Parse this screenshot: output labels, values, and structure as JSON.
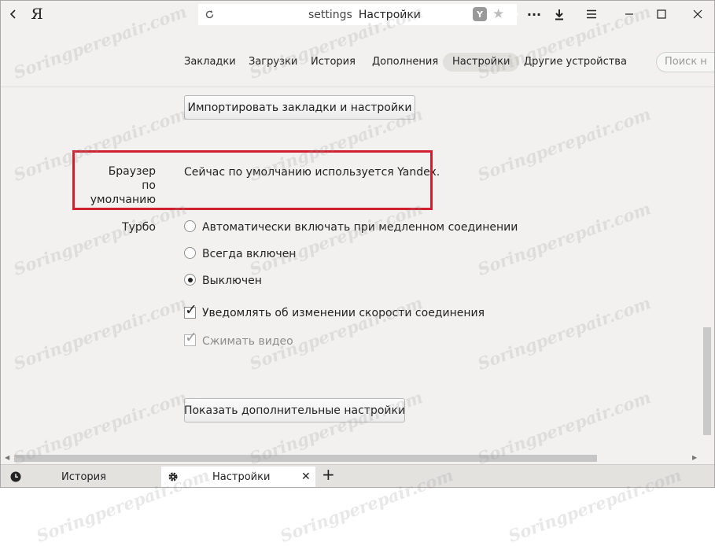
{
  "window": {
    "logo": "Я",
    "address": {
      "host": "settings",
      "title": "Настройки"
    },
    "reload_icon": "reload-icon",
    "minimize_glyph": "—",
    "maximize_glyph": "☐",
    "close_glyph": "✕"
  },
  "nav": {
    "items": [
      "Закладки",
      "Загрузки",
      "История",
      "Дополнения",
      "Настройки",
      "Другие устройства"
    ],
    "active": "Настройки",
    "search_placeholder": "Поиск н"
  },
  "settings": {
    "import_button": "Импортировать закладки и настройки",
    "default_browser": {
      "label_line1": "Браузер",
      "label_line2": "по умолчанию",
      "status": "Сейчас по умолчанию используется Yandex."
    },
    "turbo": {
      "label": "Турбо",
      "options": [
        {
          "label": "Автоматически включать при медленном соединении",
          "selected": false
        },
        {
          "label": "Всегда включен",
          "selected": false
        },
        {
          "label": "Выключен",
          "selected": true
        }
      ],
      "notify_checkbox": {
        "label": "Уведомлять об изменении скорости соединения",
        "checked": true
      },
      "compress_checkbox": {
        "label": "Сжимать видео",
        "checked": true,
        "disabled": true
      }
    },
    "more_button": "Показать дополнительные настройки"
  },
  "tabs": [
    {
      "label": "История",
      "icon": "clock-icon",
      "active": false
    },
    {
      "label": "Настройки",
      "icon": "gear-icon",
      "active": true,
      "close": "✕"
    }
  ],
  "new_tab": "+",
  "watermark": "Soringperepair.com",
  "colors": {
    "highlight": "#d0202f",
    "background": "#f2f1ef"
  }
}
